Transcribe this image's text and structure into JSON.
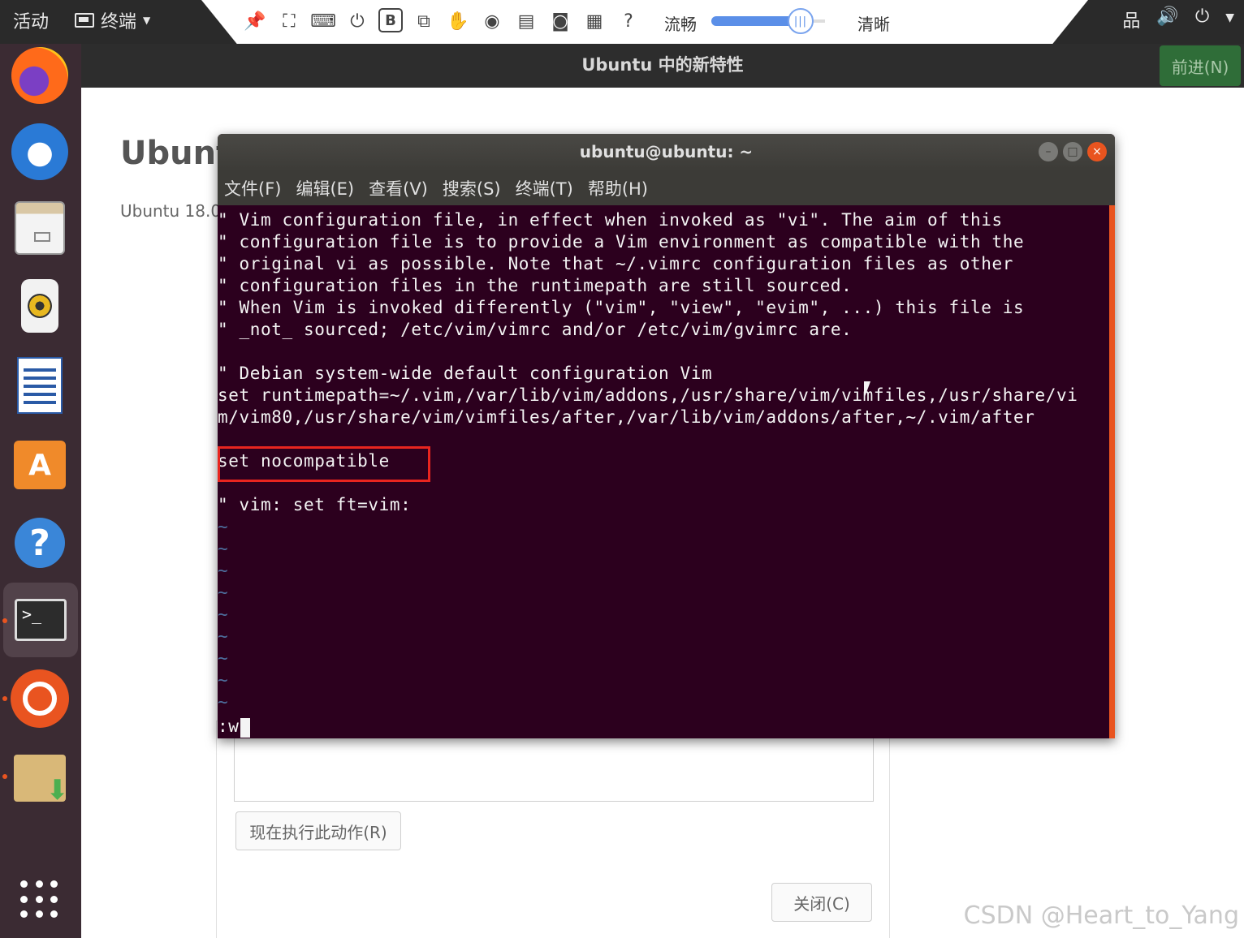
{
  "topbar": {
    "activities": "活动",
    "app_menu": "终端",
    "toolbar": {
      "icons": [
        "pin-icon",
        "fullscreen-icon",
        "keyboard-icon",
        "power-icon",
        "bold-b-icon",
        "network-share-icon",
        "hand-icon",
        "record-dot-icon",
        "save-icon",
        "camera-icon",
        "screen-keyboard-icon",
        "help-icon"
      ],
      "bold_b_label": "B",
      "help_label": "?",
      "quality_fluent": "流畅",
      "quality_clear": "清晰",
      "quality_slider_fraction": 0.82,
      "slider_knob_glyph": "|||"
    },
    "system_icons": [
      "network-icon",
      "volume-icon",
      "power-icon",
      "chevron-down-icon"
    ]
  },
  "subbar": {
    "title": "Ubuntu 中的新特性",
    "next_button": "前进(N)"
  },
  "dock": {
    "items": [
      {
        "name": "firefox-icon"
      },
      {
        "name": "thunderbird-icon"
      },
      {
        "name": "files-icon"
      },
      {
        "name": "rhythmbox-icon"
      },
      {
        "name": "writer-icon"
      },
      {
        "name": "software-center-icon",
        "glyph": "A"
      },
      {
        "name": "help-icon",
        "glyph": "?"
      },
      {
        "name": "terminal-icon",
        "glyph": ">_"
      },
      {
        "name": "ubuntu-icon"
      },
      {
        "name": "install-icon"
      },
      {
        "name": "show-apps-icon"
      }
    ],
    "active": "terminal-icon"
  },
  "background_dialog": {
    "heading": "Ubunt",
    "subtitle": "Ubuntu 18.0",
    "run_button": "现在执行此动作(R)",
    "close_button": "关闭(C)"
  },
  "terminal": {
    "title": "ubuntu@ubuntu: ~",
    "window_buttons": [
      "minimize-icon",
      "maximize-icon",
      "close-icon"
    ],
    "window_button_glyphs": [
      "–",
      "□",
      "×"
    ],
    "menu": [
      "文件(F)",
      "编辑(E)",
      "查看(V)",
      "搜索(S)",
      "终端(T)",
      "帮助(H)"
    ],
    "lines": [
      "\" Vim configuration file, in effect when invoked as \"vi\". The aim of this",
      "\" configuration file is to provide a Vim environment as compatible with the",
      "\" original vi as possible. Note that ~/.vimrc configuration files as other",
      "\" configuration files in the runtimepath are still sourced.",
      "\" When Vim is invoked differently (\"vim\", \"view\", \"evim\", ...) this file is",
      "\" _not_ sourced; /etc/vim/vimrc and/or /etc/vim/gvimrc are.",
      "",
      "\" Debian system-wide default configuration Vim",
      "set runtimepath=~/.vim,/var/lib/vim/addons,/usr/share/vim/vimfiles,/usr/share/vi",
      "m/vim80,/usr/share/vim/vimfiles/after,/var/lib/vim/addons/after,~/.vim/after",
      "",
      "set nocompatible",
      "",
      "\" vim: set ft=vim:",
      "~",
      "~",
      "~",
      "~",
      "~",
      "~",
      "~",
      "~",
      "~"
    ],
    "command_line": ":w",
    "highlighted_line": "set nocompatible"
  },
  "watermark": "CSDN @Heart_to_Yang"
}
